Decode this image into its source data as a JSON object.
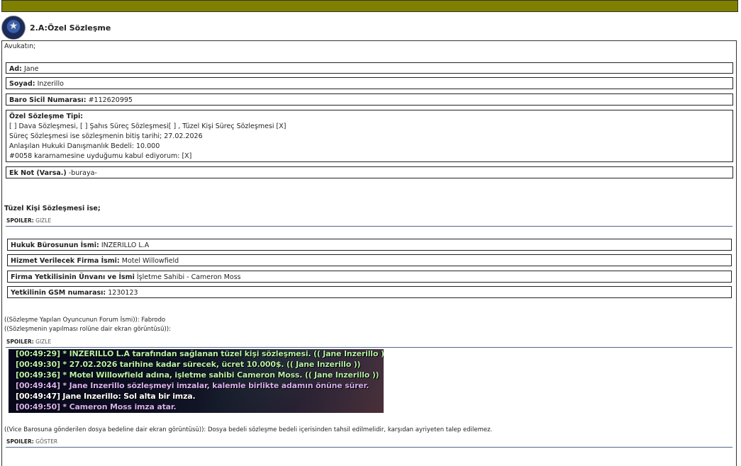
{
  "header": {
    "title": "2.A:Özel Sözleşme"
  },
  "post": {
    "intro": "Avukatın;",
    "ad": {
      "label": "Ad:",
      "value": "Jane"
    },
    "soyad": {
      "label": "Soyad:",
      "value": "Inzerillo"
    },
    "baro": {
      "label": "Baro Sicil Numarası:",
      "value": "#112620995"
    },
    "tip": {
      "label": "Özel Sözleşme Tipi:",
      "line1": "[ ] Dava Sözleşmesi, [ ] Şahıs Süreç Sözleşmesi[ ] , Tüzel Kişi Süreç Sözleşmesi [X]",
      "line2": "Süreç Sözleşmesi ise sözleşmenin bitiş tarihi; 27.02.2026",
      "line3": "Anlaşılan Hukuki Danışmanlık Bedeli: 10.000",
      "line4": "#0058 kararnamesine uyduğumu kabul ediyorum: [X]"
    },
    "eknot": {
      "label": "Ek Not (Varsa.)",
      "value": "-buraya-"
    },
    "tuzel_heading": "Tüzel Kişi Sözleşmesi ise;",
    "spoiler1": {
      "label": "SPOILER:",
      "state": "GIZLE"
    },
    "buro": {
      "label": "Hukuk Bürosunun İsmi:",
      "value": "INZERILLO L.A"
    },
    "firma": {
      "label": "Hizmet Verilecek Firma İsmi:",
      "value": "Motel Willowfield"
    },
    "yetkili": {
      "label": "Firma Yetkilisinin Ünvanı ve İsmi",
      "value": "İşletme Sahibi - Cameron Moss"
    },
    "gsm": {
      "label": "Yetkilinin GSM numarası:",
      "value": "1230123"
    },
    "forum_name": "((Sözleşme Yapılan Oyuncunun Forum İsmi)): Fabrodo",
    "screenshot_note": "((Sözleşmenin yapılması rolüne dair ekran görüntüsü)):",
    "spoiler2": {
      "label": "SPOILER:",
      "state": "GIZLE"
    },
    "chat": [
      "[00:49:29] * INZERILLO L.A tarafından sağlanan tüzel kişi sözleşmesi. (( Jane Inzerillo ))",
      "[00:49:30] * 27.02.2026 tarihine kadar sürecek, ücret 10.000$. (( Jane Inzerillo ))",
      "[00:49:36] * Motel Willowfield adına, işletme sahibi Cameron Moss.  (( Jane Inzerillo ))",
      "[00:49:44] * Jane Inzerillo sözleşmeyi imzalar, kalemle birlikte adamın önüne sürer.",
      "[00:49:47] Jane Inzerillo: Sol alta bir imza.",
      "[00:49:50] * Cameron Moss imza atar."
    ],
    "vice_note": "((Vice Barosuna gönderilen dosya bedeline dair ekran görüntüsü)): Dosya bedeli sözleşme bedeli içerisinden tahsil edilmelidir, karşıdan ayriyeten talep edilemez.",
    "spoiler3": {
      "label": "SPOILER:",
      "state": "GÖSTER"
    }
  },
  "colors": {
    "topbar": "#808000",
    "chat_green": "#b8f0a8",
    "chat_purple": "#d8b0f0",
    "chat_white": "#ffffff"
  }
}
